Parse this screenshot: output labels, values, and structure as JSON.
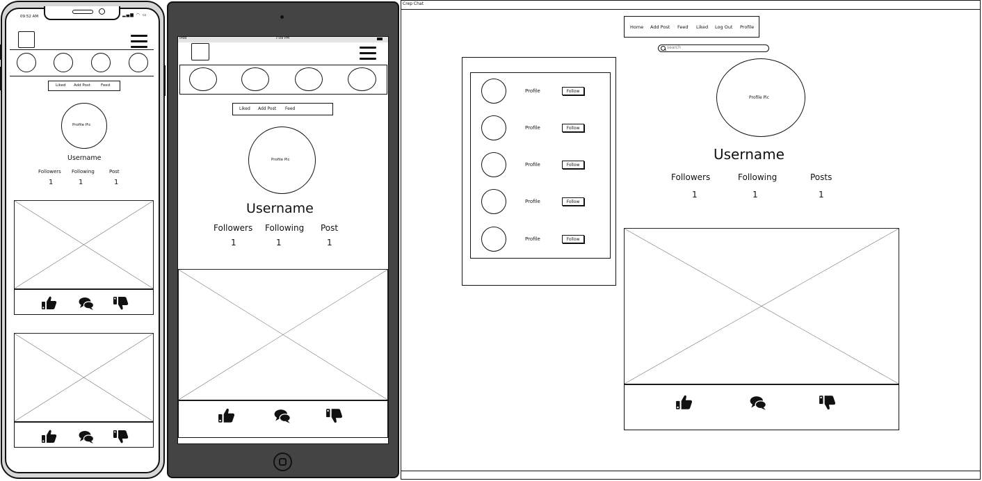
{
  "phone": {
    "status_time": "09:52 AM",
    "nav_links": [
      "Liked",
      "Add Post",
      "Feed"
    ],
    "profile_pic": "Profile Pic",
    "username": "Username",
    "stats": {
      "followers_label": "Followers",
      "following_label": "Following",
      "post_label": "Post",
      "followers": "1",
      "following": "1",
      "post": "1"
    }
  },
  "tablet": {
    "status_left": "iPod",
    "status_time": "7:09 PM",
    "nav_links": [
      "Liked",
      "Add Post",
      "Feed"
    ],
    "profile_pic": "Profile Pic",
    "username": "Username",
    "stats": {
      "followers_label": "Followers",
      "following_label": "Following",
      "post_label": "Post",
      "followers": "1",
      "following": "1",
      "post": "1"
    }
  },
  "desktop": {
    "window_title": "Crep Chat",
    "nav_links": [
      "Home",
      "Add Post",
      "Feed",
      "Liked",
      "Log Out",
      "Profile"
    ],
    "search_placeholder": "search",
    "profile_pic": "Profile Pic",
    "username": "Username",
    "stats": {
      "followers_label": "Followers",
      "following_label": "Following",
      "posts_label": "Posts",
      "followers": "1",
      "following": "1",
      "posts": "1"
    },
    "suggestions": [
      {
        "label": "Profile",
        "button": "Follow"
      },
      {
        "label": "Profile",
        "button": "Follow"
      },
      {
        "label": "Profile",
        "button": "Follow"
      },
      {
        "label": "Profile",
        "button": "Follow"
      },
      {
        "label": "Profile",
        "button": "Follow"
      }
    ]
  },
  "icons": [
    "thumbs-up-icon",
    "comment-icon",
    "thumbs-down-icon",
    "search-icon",
    "menu-icon",
    "home-button-icon"
  ]
}
